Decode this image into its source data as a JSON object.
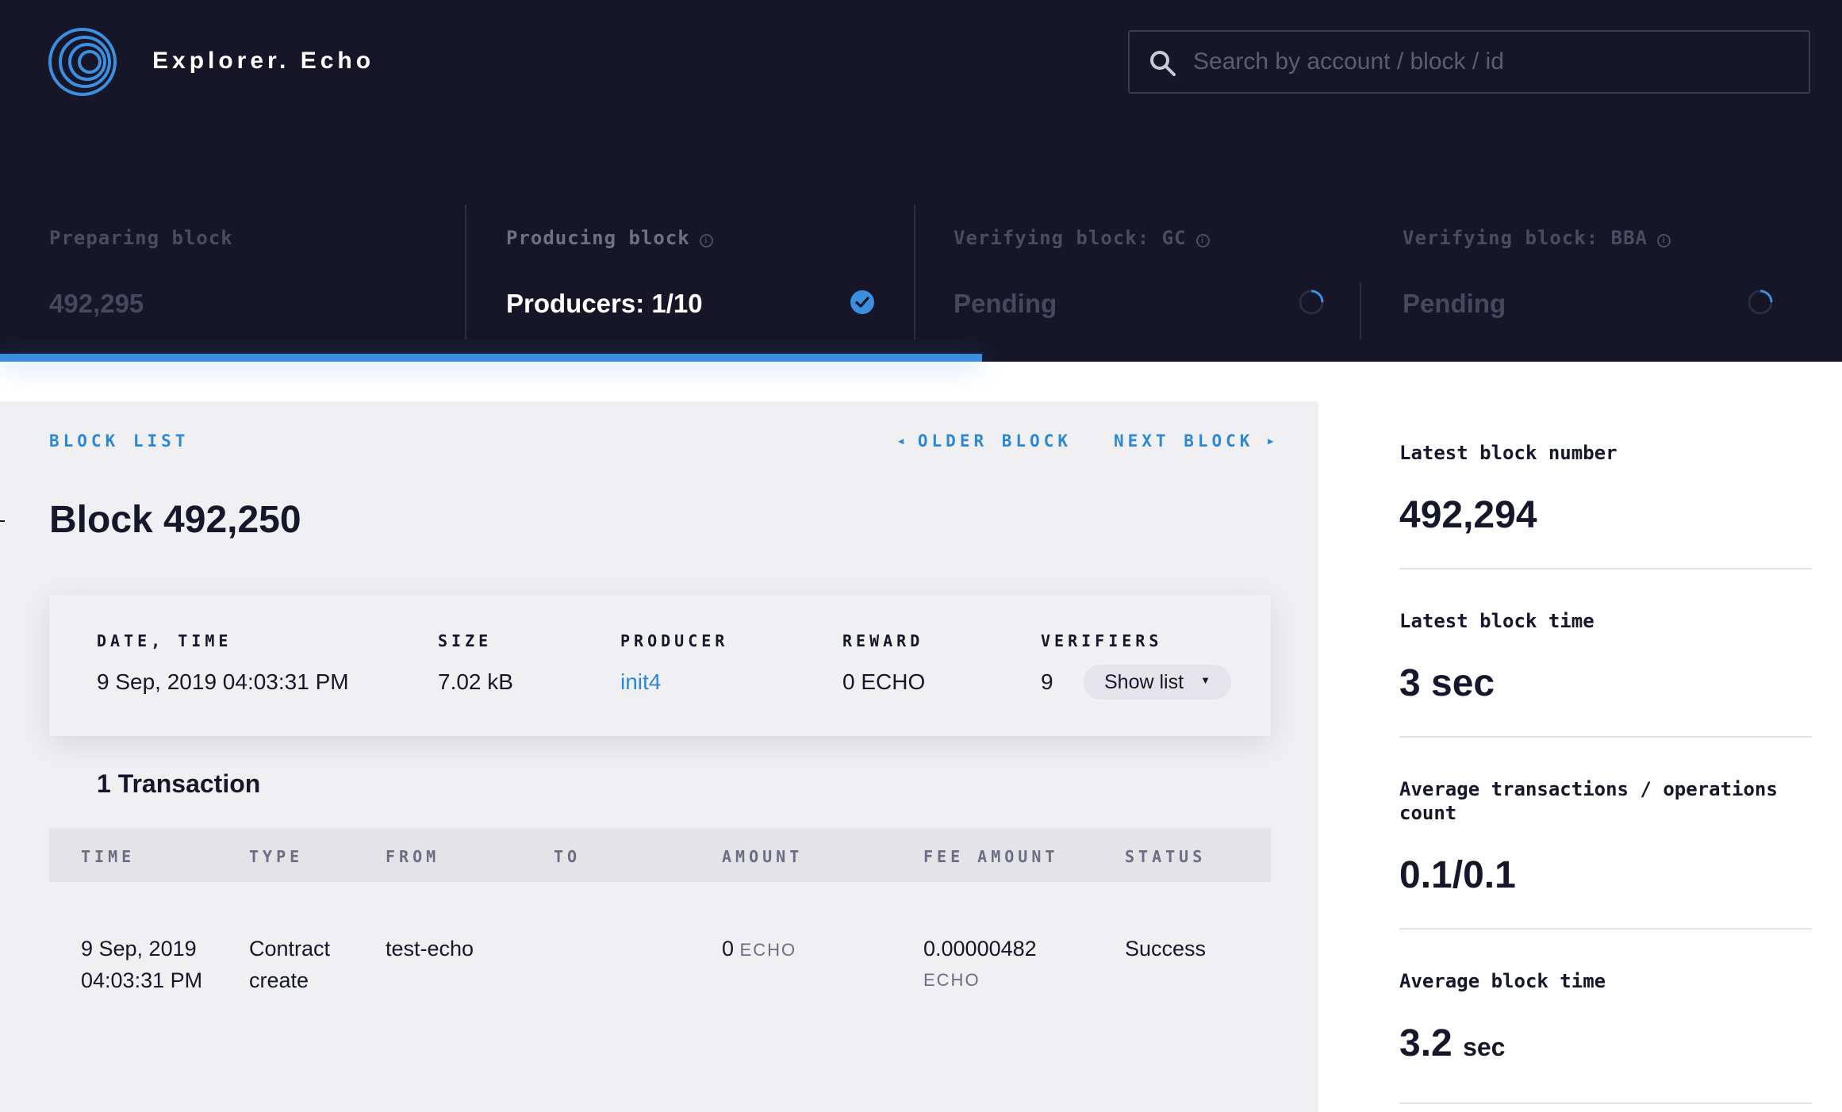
{
  "header": {
    "brand": "Explorer. Echo",
    "search_placeholder": "Search by account / block / id",
    "stages": [
      {
        "label": "Preparing block",
        "value": "492,295",
        "info": false,
        "status": "done"
      },
      {
        "label": "Producing block",
        "value": "Producers: 1/10",
        "info": true,
        "status": "active-check"
      },
      {
        "label": "Verifying block: GC",
        "value": "Pending",
        "info": true,
        "status": "pending"
      },
      {
        "label": "Verifying block: BBA",
        "value": "Pending",
        "info": true,
        "status": "pending"
      }
    ],
    "progress_fraction": 0.533
  },
  "nav": {
    "block_list": "BLOCK LIST",
    "older_block": "OLDER BLOCK",
    "next_block": "NEXT BLOCK"
  },
  "block": {
    "title": "Block 492,250",
    "date_label": "DATE, TIME",
    "date_value": "9 Sep, 2019 04:03:31 PM",
    "size_label": "SIZE",
    "size_value": "7.02 kB",
    "producer_label": "PRODUCER",
    "producer_value": "init4",
    "reward_label": "REWARD",
    "reward_value": "0 ECHO",
    "verifiers_label": "VERIFIERS",
    "verifiers_value": "9",
    "show_list": "Show list"
  },
  "transactions": {
    "count_label": "1 Transaction",
    "columns": [
      "TIME",
      "TYPE",
      "FROM",
      "TO",
      "AMOUNT",
      "FEE AMOUNT",
      "STATUS"
    ],
    "rows": [
      {
        "time_date": "9 Sep, 2019",
        "time_clock": "04:03:31 PM",
        "type_line1": "Contract",
        "type_line2": "create",
        "from": "test-echo",
        "to": "",
        "amount": "0",
        "amount_unit": "ECHO",
        "fee": "0.00000482",
        "fee_unit": "ECHO",
        "status": "Success"
      }
    ]
  },
  "stats": {
    "latest_block_number_label": "Latest block number",
    "latest_block_number": "492,294",
    "latest_block_time_label": "Latest block time",
    "latest_block_time": "3 sec",
    "avg_tx_label": "Average transactions / operations count",
    "avg_tx_value": "0.1/0.1",
    "avg_block_time_label": "Average block time",
    "avg_block_time_value": "3.2",
    "avg_block_time_unit": "sec"
  },
  "colors": {
    "header_bg": "#161628",
    "accent": "#2d88d4",
    "progress": "#3c8fdf",
    "panel_bg": "#f0f0f3"
  }
}
